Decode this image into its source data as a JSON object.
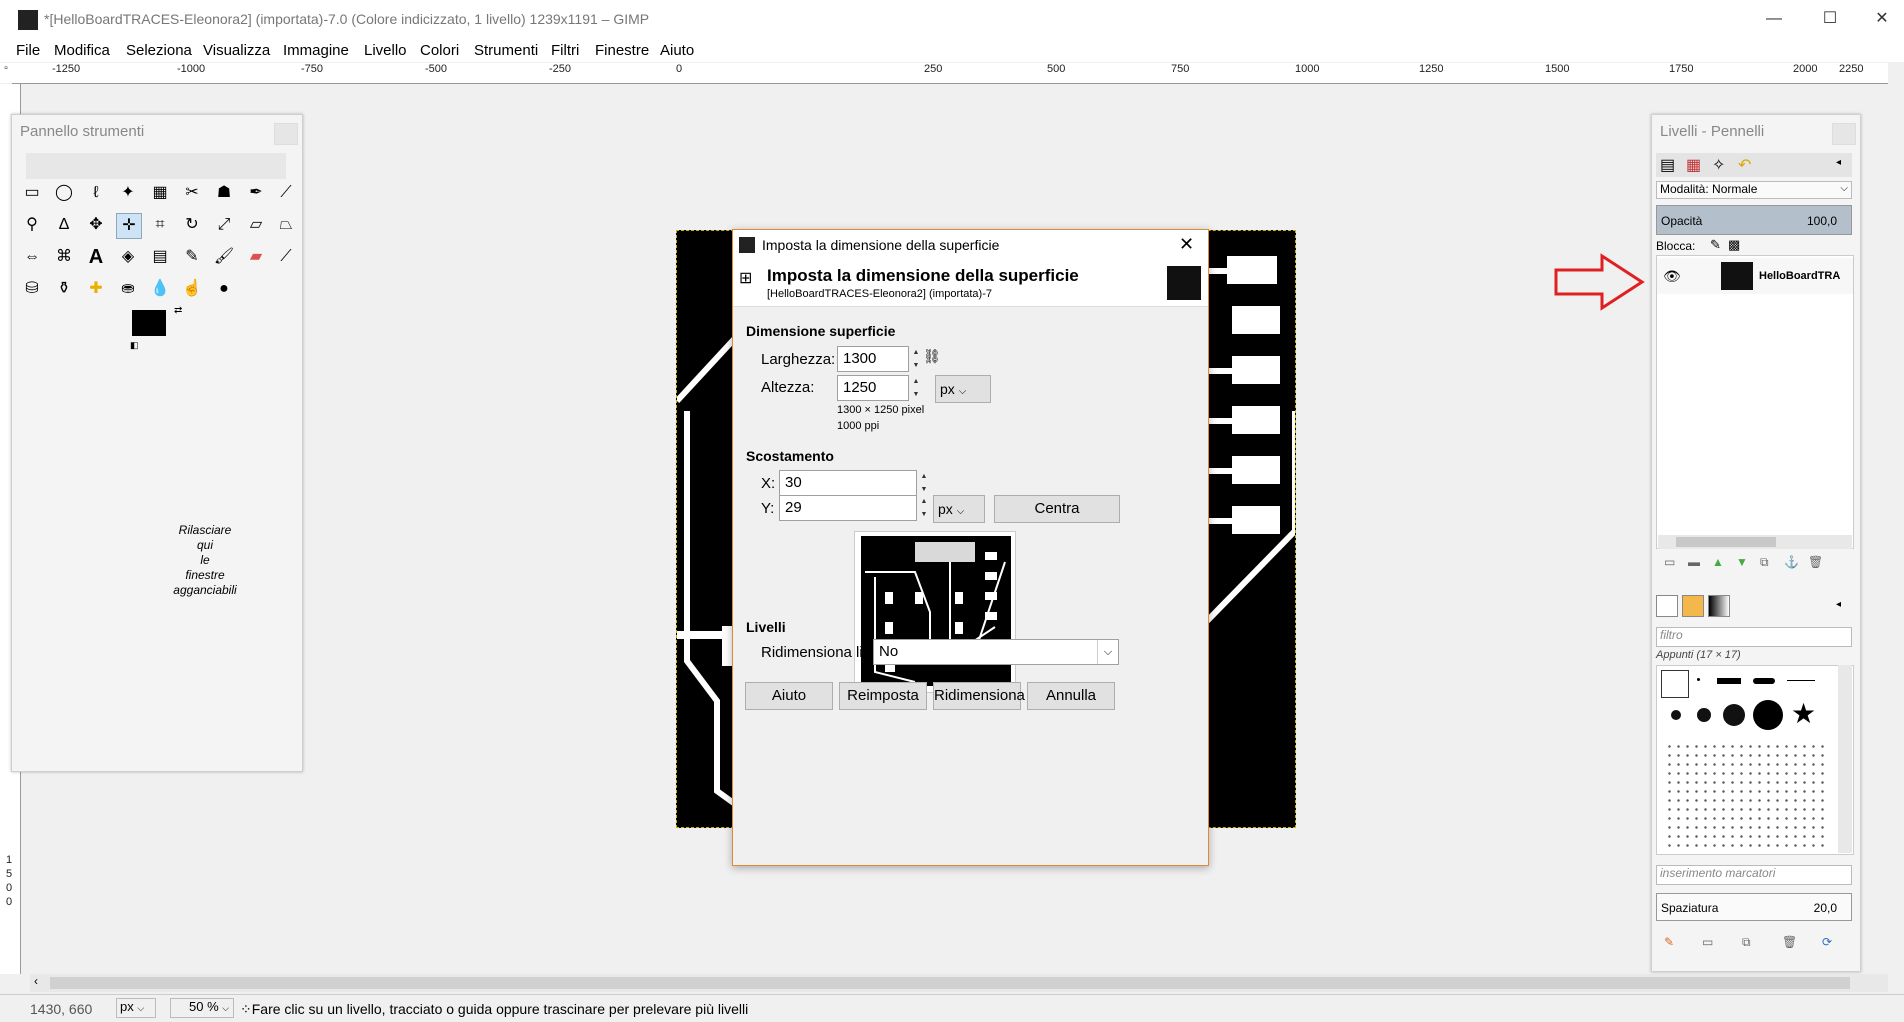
{
  "window": {
    "title": "*[HelloBoardTRACES-Eleonora2] (importata)-7.0 (Colore indicizzato, 1 livello) 1239x1191 – GIMP",
    "minimize": "—",
    "maximize": "☐",
    "close": "✕"
  },
  "menubar": {
    "items": [
      "File",
      "Modifica",
      "Seleziona",
      "Visualizza",
      "Immagine",
      "Livello",
      "Colori",
      "Strumenti",
      "Filtri",
      "Finestre",
      "Aiuto"
    ]
  },
  "ruler": {
    "ticks": [
      "-1250",
      "-1000",
      "-750",
      "-500",
      "-250",
      "0",
      "250",
      "500",
      "750",
      "1000",
      "1250",
      "1500",
      "1750",
      "2000",
      "2250"
    ],
    "vticks": [
      "1",
      "5",
      "0",
      "0"
    ]
  },
  "toolbox": {
    "title": "Pannello strumenti",
    "drop_text": [
      "Rilasciare",
      "qui",
      "le",
      "finestre",
      "agganciabili"
    ]
  },
  "layers_dock": {
    "title": "Livelli - Pennelli",
    "mode_label": "Modalità: Normale",
    "opacity_label": "Opacità",
    "opacity_value": "100,0",
    "lock_label": "Blocca:",
    "layer_name": "HelloBoardTRA",
    "filter_placeholder": "filtro",
    "brush_set": "Appunti (17 × 17)",
    "tag_placeholder": "inserimento marcatori",
    "spacing_label": "Spaziatura",
    "spacing_value": "20,0"
  },
  "dialog": {
    "window_title": "Imposta la dimensione della superficie",
    "header_title": "Imposta la dimensione della superficie",
    "header_subtitle": "[HelloBoardTRACES-Eleonora2] (importata)-7",
    "section_size": "Dimensione superficie",
    "width_label": "Larghezza:",
    "width_value": "1300",
    "height_label": "Altezza:",
    "height_value": "1250",
    "unit": "px",
    "size_info": "1300 × 1250 pixel",
    "ppi_info": "1000 ppi",
    "section_offset": "Scostamento",
    "x_label": "X:",
    "x_value": "30",
    "y_label": "Y:",
    "y_value": "29",
    "offset_unit": "px",
    "center_button": "Centra",
    "section_layers": "Livelli",
    "resize_layers_label": "Ridimensiona livelli:",
    "resize_layers_value": "No",
    "help_button": "Aiuto",
    "reset_button": "Reimposta",
    "resize_button": "Ridimensiona",
    "cancel_button": "Annulla"
  },
  "statusbar": {
    "coords": "1430, 660",
    "unit": "px",
    "zoom": "50 %",
    "message": "Fare clic su un livello, tracciato o guida oppure trascinare per prelevare più livelli"
  },
  "colors": {
    "accent": "#e0893a",
    "arrow": "#e02020"
  }
}
